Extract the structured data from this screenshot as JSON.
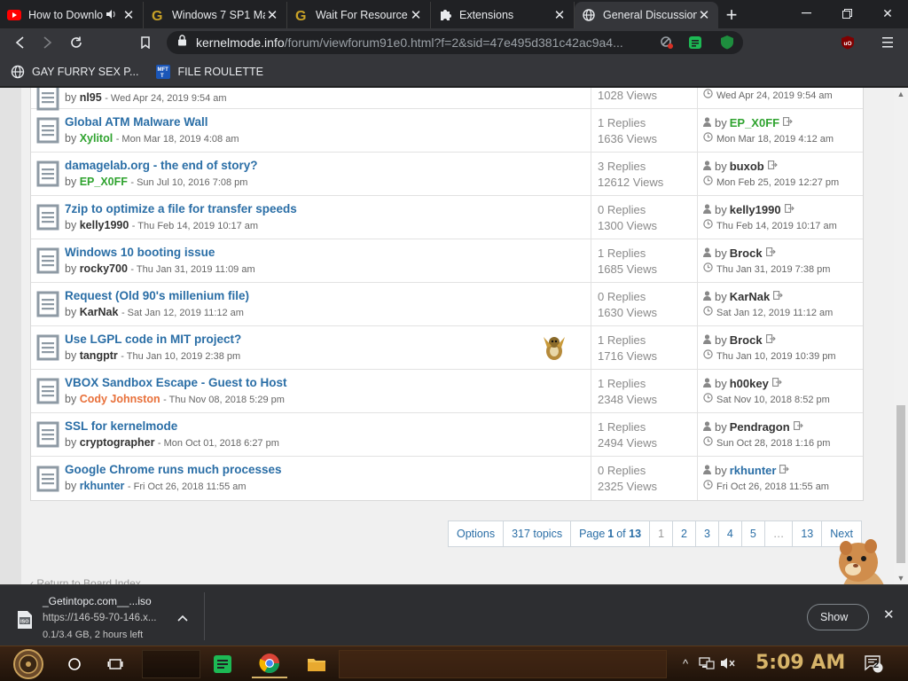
{
  "browser": {
    "tabs": [
      {
        "title": "How to Downlo",
        "icon": "youtube-icon",
        "extra": "🔊",
        "active": false
      },
      {
        "title": "Windows 7 SP1 Ma",
        "icon": "g-icon",
        "active": false
      },
      {
        "title": "Wait For Resource",
        "icon": "g-icon",
        "active": false
      },
      {
        "title": "Extensions",
        "icon": "puzzle-icon",
        "active": false
      },
      {
        "title": "General Discussion",
        "icon": "globe-icon",
        "active": true
      }
    ],
    "url_host": "kernelmode.info",
    "url_path": "/forum/viewforum91e0.html?f=2&sid=47e495d381c42ac9a4...",
    "bookmarks": [
      {
        "label": "GAY FURRY SEX P...",
        "icon": "globe-icon"
      },
      {
        "label": "FILE ROULETTE",
        "icon": "mft-icon"
      }
    ]
  },
  "topics": [
    {
      "title": "",
      "by_label": "by",
      "author": "nl95",
      "author_color": "#333333",
      "date": "- Wed Apr 24, 2019 9:54 am",
      "replies": "",
      "views": "1028",
      "last_by_label": "",
      "last_author": "",
      "last_author_color": "#333333",
      "last_date": "Wed Apr 24, 2019 9:54 am",
      "partial": true
    },
    {
      "title": "Global ATM Malware Wall",
      "by_label": "by",
      "author": "Xylitol",
      "author_color": "#2fa32f",
      "date": "- Mon Mar 18, 2019 4:08 am",
      "replies": "1",
      "views": "1636",
      "last_by_label": "by",
      "last_author": "EP_X0FF",
      "last_author_color": "#2fa32f",
      "last_date": "Mon Mar 18, 2019 4:12 am"
    },
    {
      "title": "damagelab.org - the end of story?",
      "by_label": "by",
      "author": "EP_X0FF",
      "author_color": "#2fa32f",
      "date": "- Sun Jul 10, 2016 7:08 pm",
      "replies": "3",
      "views": "12612",
      "last_by_label": "by",
      "last_author": "buxob",
      "last_author_color": "#333333",
      "last_date": "Mon Feb 25, 2019 12:27 pm"
    },
    {
      "title": "7zip to optimize a file for transfer speeds",
      "by_label": "by",
      "author": "kelly1990",
      "author_color": "#333333",
      "date": "- Thu Feb 14, 2019 10:17 am",
      "replies": "0",
      "views": "1300",
      "last_by_label": "by",
      "last_author": "kelly1990",
      "last_author_color": "#333333",
      "last_date": "Thu Feb 14, 2019 10:17 am"
    },
    {
      "title": "Windows 10 booting issue",
      "by_label": "by",
      "author": "rocky700",
      "author_color": "#333333",
      "date": "- Thu Jan 31, 2019 11:09 am",
      "replies": "1",
      "views": "1685",
      "last_by_label": "by",
      "last_author": "Brock",
      "last_author_color": "#333333",
      "last_date": "Thu Jan 31, 2019 7:38 pm"
    },
    {
      "title": "Request (Old 90's millenium file)",
      "by_label": "by",
      "author": "KarNak",
      "author_color": "#333333",
      "date": "- Sat Jan 12, 2019 11:12 am",
      "replies": "0",
      "views": "1630",
      "last_by_label": "by",
      "last_author": "KarNak",
      "last_author_color": "#333333",
      "last_date": "Sat Jan 12, 2019 11:12 am"
    },
    {
      "title": "Use LGPL code in MIT project?",
      "by_label": "by",
      "author": "tangptr",
      "author_color": "#333333",
      "date": "- Thu Jan 10, 2019 2:38 pm",
      "replies": "1",
      "views": "1716",
      "last_by_label": "by",
      "last_author": "Brock",
      "last_author_color": "#333333",
      "last_date": "Thu Jan 10, 2019 10:39 pm"
    },
    {
      "title": "VBOX Sandbox Escape - Guest to Host",
      "by_label": "by",
      "author": "Cody Johnston",
      "author_color": "#e8703a",
      "date": "- Thu Nov 08, 2018 5:29 pm",
      "replies": "1",
      "views": "2348",
      "last_by_label": "by",
      "last_author": "h00key",
      "last_author_color": "#333333",
      "last_date": "Sat Nov 10, 2018 8:52 pm"
    },
    {
      "title": "SSL for kernelmode",
      "by_label": "by",
      "author": "cryptographer",
      "author_color": "#333333",
      "date": "- Mon Oct 01, 2018 6:27 pm",
      "replies": "1",
      "views": "2494",
      "last_by_label": "by",
      "last_author": "Pendragon",
      "last_author_color": "#333333",
      "last_date": "Sun Oct 28, 2018 1:16 pm"
    },
    {
      "title": "Google Chrome runs much processes",
      "by_label": "by",
      "author": "rkhunter",
      "author_color": "#2a6ea6",
      "date": "- Fri Oct 26, 2018 11:55 am",
      "replies": "0",
      "views": "2325",
      "last_by_label": "by",
      "last_author": "rkhunter",
      "last_author_color": "#2a6ea6",
      "last_date": "Fri Oct 26, 2018 11:55 am"
    }
  ],
  "labels": {
    "replies": "Replies",
    "views": "Views"
  },
  "pagination": {
    "options": "Options",
    "topics_count": "317 topics",
    "page_prefix": "Page",
    "page_current": "1",
    "page_of": "of",
    "page_total": "13",
    "pages": [
      "1",
      "2",
      "3",
      "4",
      "5",
      "…",
      "13"
    ],
    "next": "Next"
  },
  "back_link": "Return to Board Index",
  "download": {
    "filename": "_Getintopc.com__...iso",
    "source": "https://146-59-70-146.x...",
    "progress": "0.1/3.4 GB, 2 hours left",
    "show_all": "Show"
  },
  "taskbar": {
    "time": "5:09 AM",
    "notifications": "2"
  },
  "colors": {
    "link": "#2a6ea6",
    "green_user": "#2fa32f",
    "orange_user": "#e8703a",
    "chrome_dark": "#202124",
    "chrome_mid": "#35363a"
  }
}
